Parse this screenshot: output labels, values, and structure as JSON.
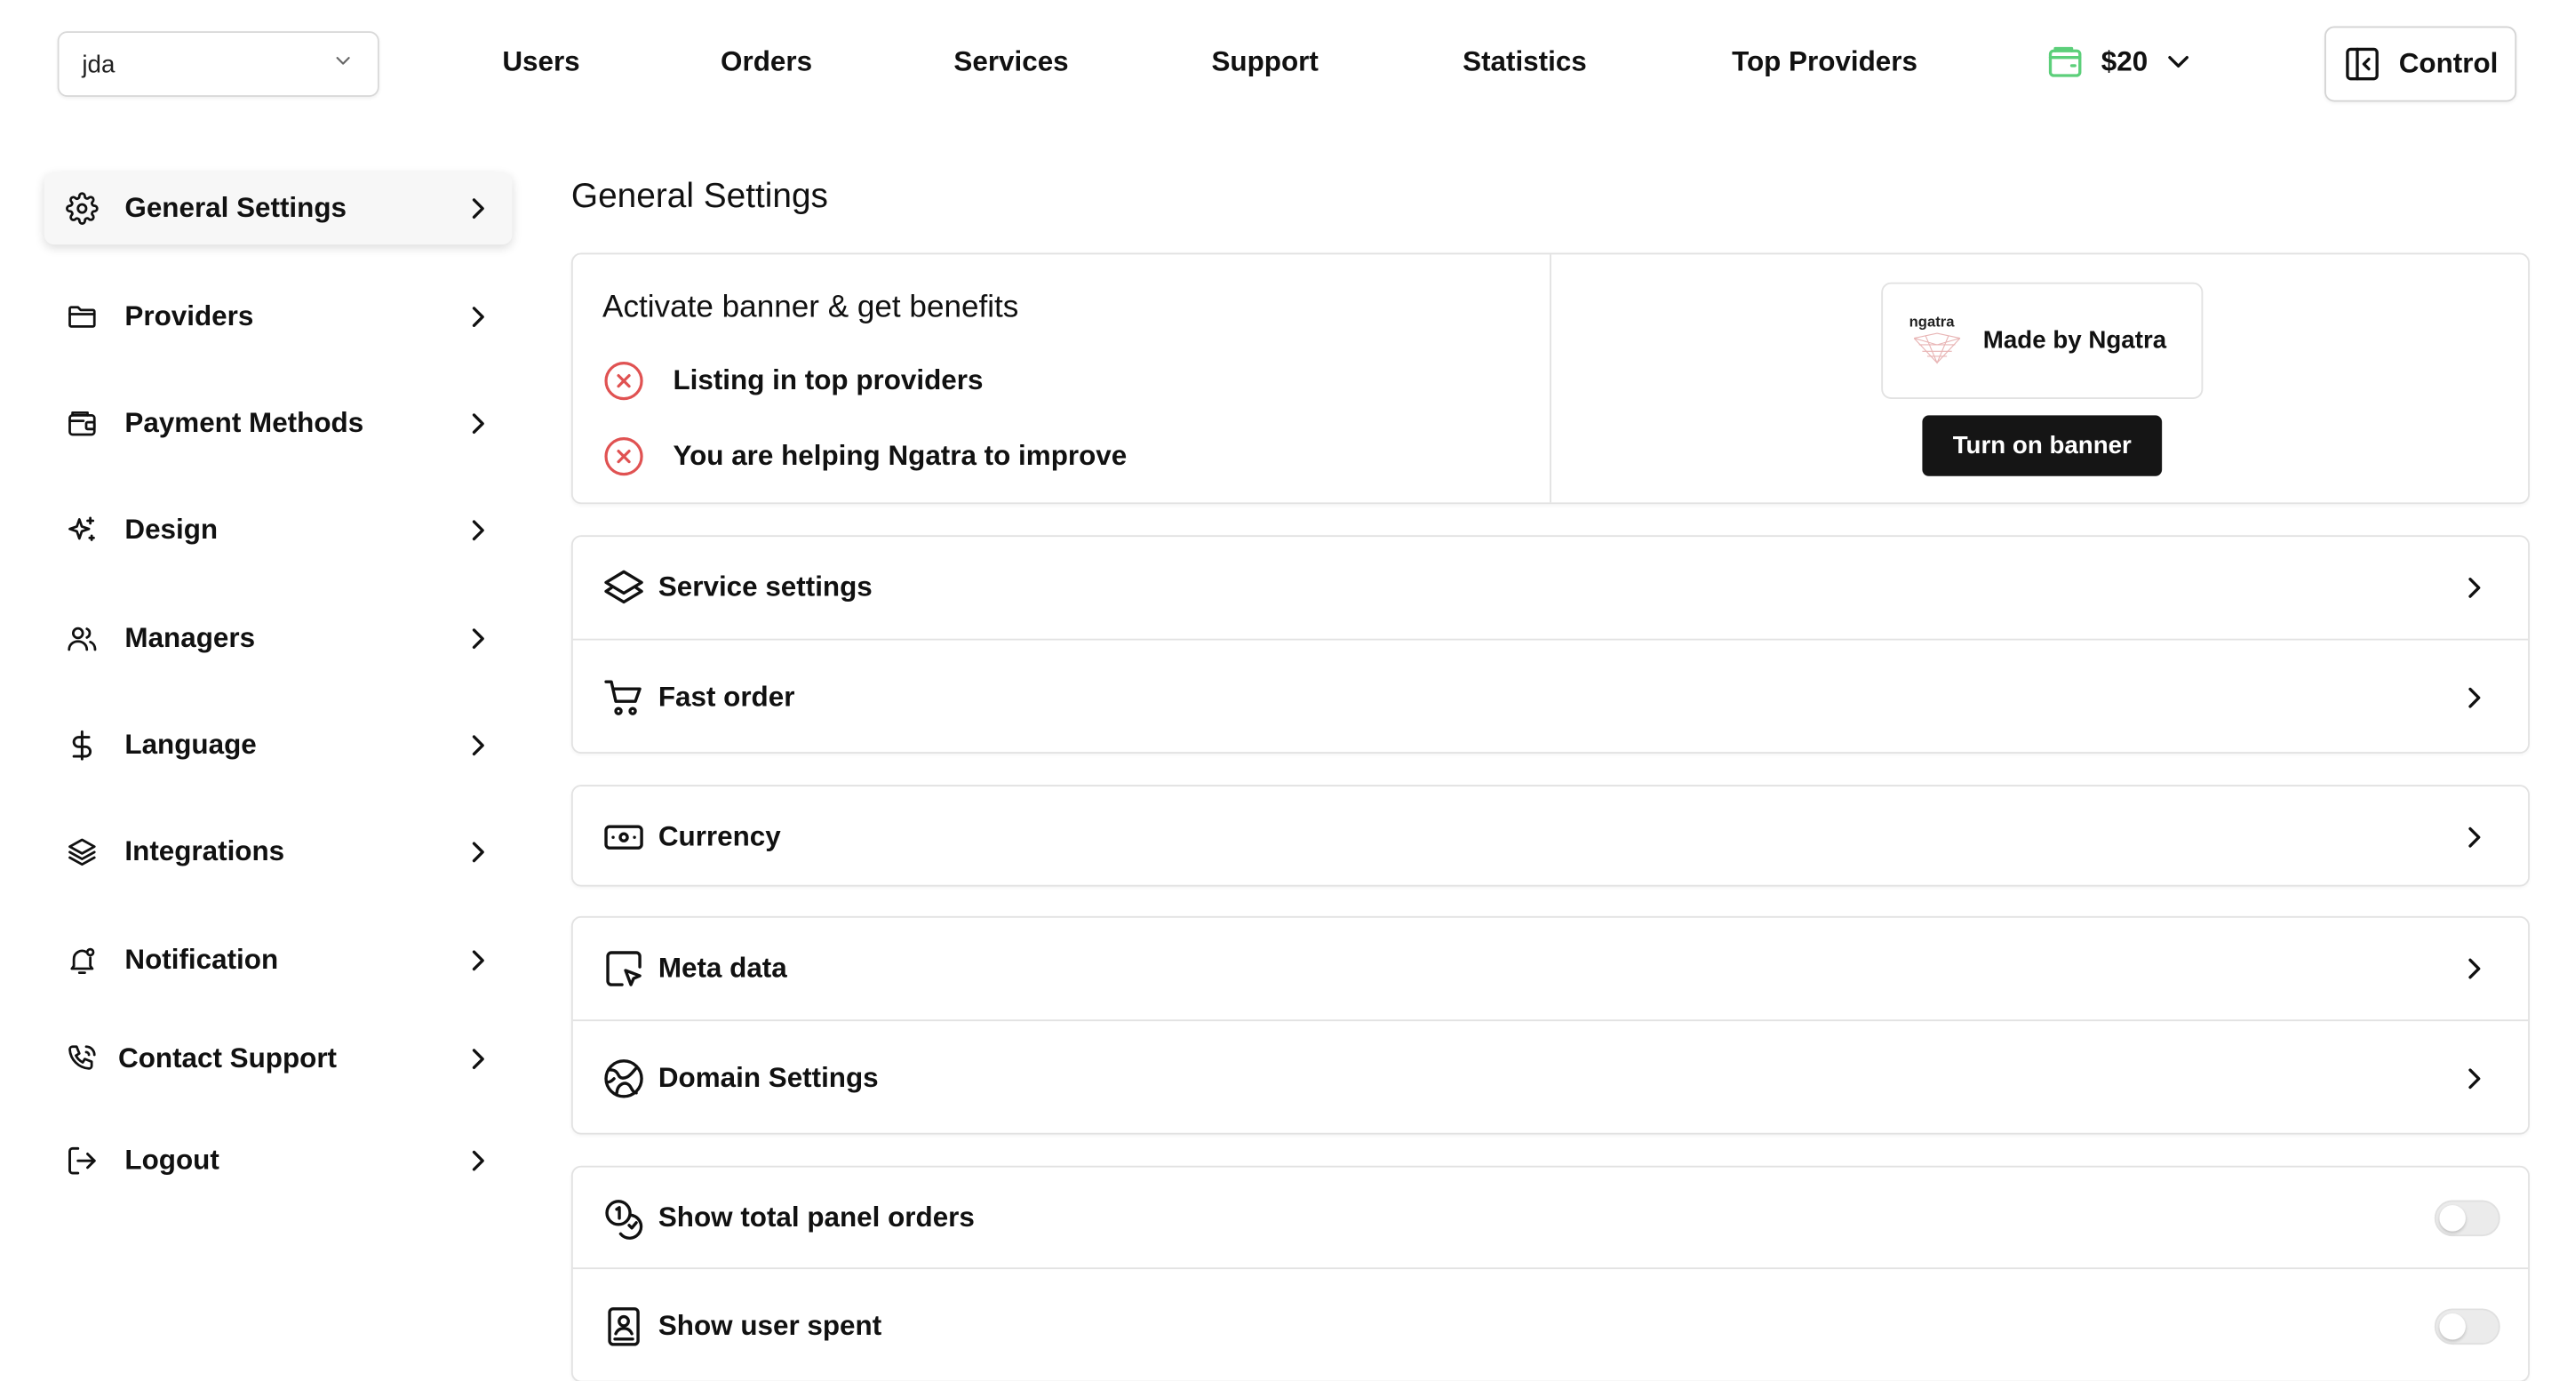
{
  "panel_select": {
    "value": "jda"
  },
  "nav": {
    "users": "Users",
    "orders": "Orders",
    "services": "Services",
    "support": "Support",
    "statistics": "Statistics",
    "top_providers": "Top Providers"
  },
  "balance": {
    "amount": "$20",
    "icon_color": "#5ccf7a"
  },
  "control": {
    "label": "Control"
  },
  "sidebar": {
    "items": [
      {
        "label": "General Settings",
        "icon": "gear-icon",
        "active": true
      },
      {
        "label": "Providers",
        "icon": "folder-icon"
      },
      {
        "label": "Payment Methods",
        "icon": "wallet-icon"
      },
      {
        "label": "Design",
        "icon": "sparkles-icon"
      },
      {
        "label": "Managers",
        "icon": "users-icon"
      },
      {
        "label": "Language",
        "icon": "dollar-icon"
      },
      {
        "label": "Integrations",
        "icon": "layers-icon"
      },
      {
        "label": "Notification",
        "icon": "bell-icon"
      },
      {
        "label": "Contact Support",
        "icon": "phone-icon"
      },
      {
        "label": "Logout",
        "icon": "logout-icon"
      }
    ]
  },
  "main": {
    "title": "General Settings",
    "banner": {
      "title": "Activate banner & get benefits",
      "benefits": [
        "Listing in top providers",
        "You are helping Ngatra to improve"
      ],
      "preview_logo_text": "ngatra",
      "preview_text": "Made by Ngatra",
      "button": "Turn on banner",
      "status_color": "#e05252"
    },
    "rows": {
      "service_settings": "Service settings",
      "fast_order": "Fast order",
      "currency": "Currency",
      "meta_data": "Meta data",
      "domain_settings": "Domain Settings",
      "show_total_panel_orders": "Show total panel orders",
      "show_user_spent": "Show user spent"
    },
    "toggles": {
      "show_total_panel_orders": false,
      "show_user_spent": false
    }
  }
}
